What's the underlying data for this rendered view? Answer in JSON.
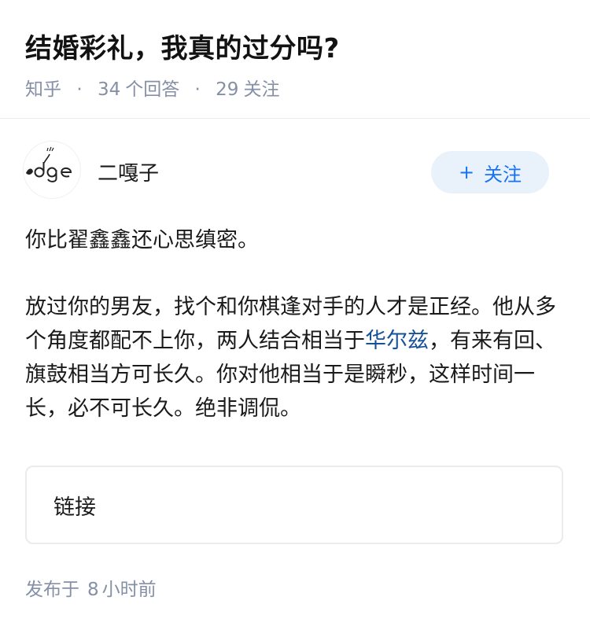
{
  "question": {
    "title": "结婚彩礼，我真的过分吗?",
    "meta": {
      "source": "知乎",
      "answers_count": "34",
      "answers_label": "个回答",
      "followers_count": "29",
      "followers_label": "关注",
      "separator": "·"
    }
  },
  "author": {
    "name": "二嘎子",
    "avatar_icon": "edge-logo-avatar",
    "follow_button": {
      "plus": "+",
      "label": "关注"
    }
  },
  "answer": {
    "paragraph_1": "你比翟鑫鑫还心思缜密。",
    "paragraph_2_before_link": "放过你的男友，找个和你棋逢对手的人才是正经。他从多个角度都配不上你，两人结合相当于",
    "link_text": "华尔兹",
    "paragraph_2_after_link": "，有来有回、旗鼓相当方可长久。你对他相当于是瞬秒，这样时间一长，必不可长久。绝非调侃。"
  },
  "link_card": {
    "label": "链接"
  },
  "publish": {
    "prefix": "发布于",
    "number": "8",
    "unit": "小时前"
  },
  "colors": {
    "title": "#121212",
    "meta": "#8590a6",
    "link": "#175199",
    "follow_bg": "#e9f1fb",
    "follow_text": "#1772f6"
  }
}
